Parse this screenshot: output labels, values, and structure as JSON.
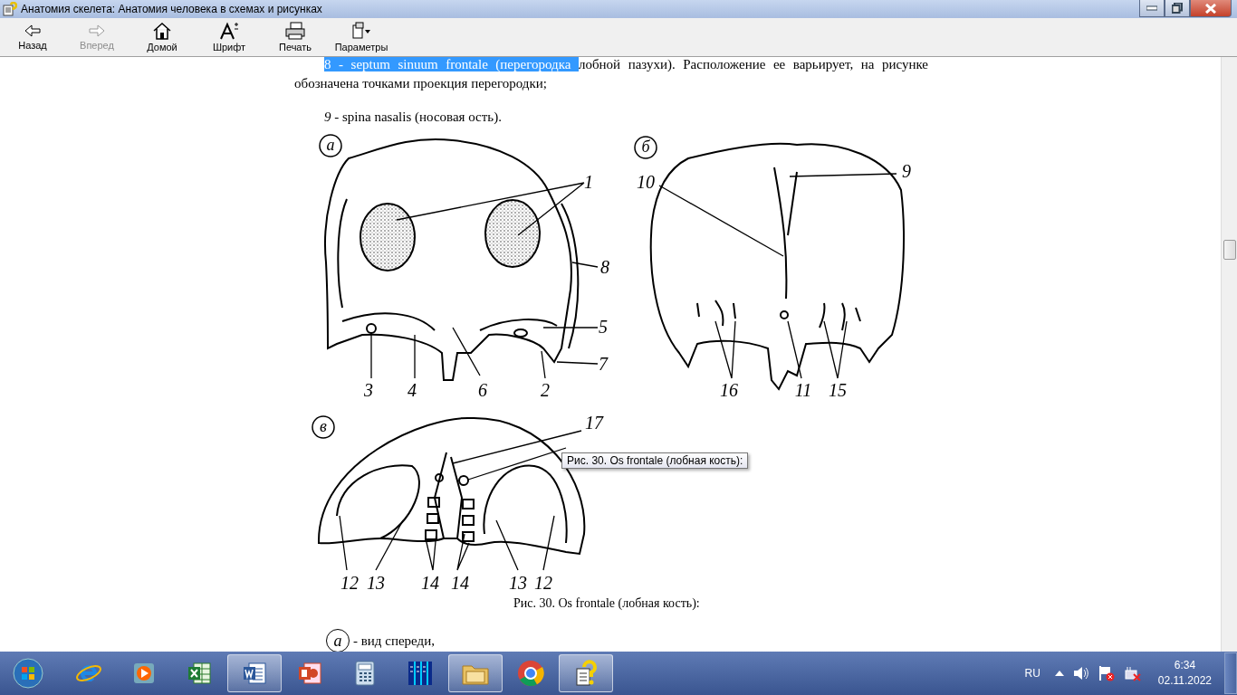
{
  "window": {
    "title": "Анатомия скелета: Анатомия человека в схемах и рисунках"
  },
  "toolbar": [
    {
      "label": "Назад",
      "disabled": false
    },
    {
      "label": "Вперед",
      "disabled": true
    },
    {
      "label": "Домой",
      "disabled": false
    },
    {
      "label": "Шрифт",
      "disabled": false
    },
    {
      "label": "Печать",
      "disabled": false
    },
    {
      "label": "Параметры",
      "disabled": false
    }
  ],
  "content": {
    "paragraph": [
      {
        "text": "8 - septum sinuum frontale (перегородка ",
        "selected": true
      },
      {
        "text": "лобной пазухи). Расположение ее варьирует, на рисунке обозначена точками проекция перегородки;",
        "selected": false
      }
    ],
    "item_9": {
      "number": "9",
      "text": " - spina nasalis (носовая ость)."
    },
    "figure": {
      "panels": [
        {
          "letter": "а",
          "labels": [
            "1",
            "8",
            "5",
            "7",
            "3",
            "4",
            "6",
            "2"
          ]
        },
        {
          "letter": "б",
          "labels": [
            "10",
            "9",
            "16",
            "11",
            "15"
          ]
        },
        {
          "letter": "в",
          "labels": [
            "17",
            "12",
            "13",
            "14",
            "14",
            "13",
            "12"
          ]
        }
      ]
    },
    "caption": "Рис. 30. Os frontale (лобная кость):",
    "legend": {
      "letter": "а",
      "text": "- вид спереди,"
    },
    "tooltip": "Рис. 30. Os frontale (лобная кость):"
  },
  "taskbar": {
    "apps": [
      {
        "running": false
      },
      {
        "running": false
      },
      {
        "running": false
      },
      {
        "running": true
      },
      {
        "running": false
      },
      {
        "running": false
      },
      {
        "running": false
      },
      {
        "running": true
      },
      {
        "running": false
      },
      {
        "running": true
      }
    ],
    "language": "RU",
    "time": "6:34",
    "date": "02.11.2022"
  }
}
